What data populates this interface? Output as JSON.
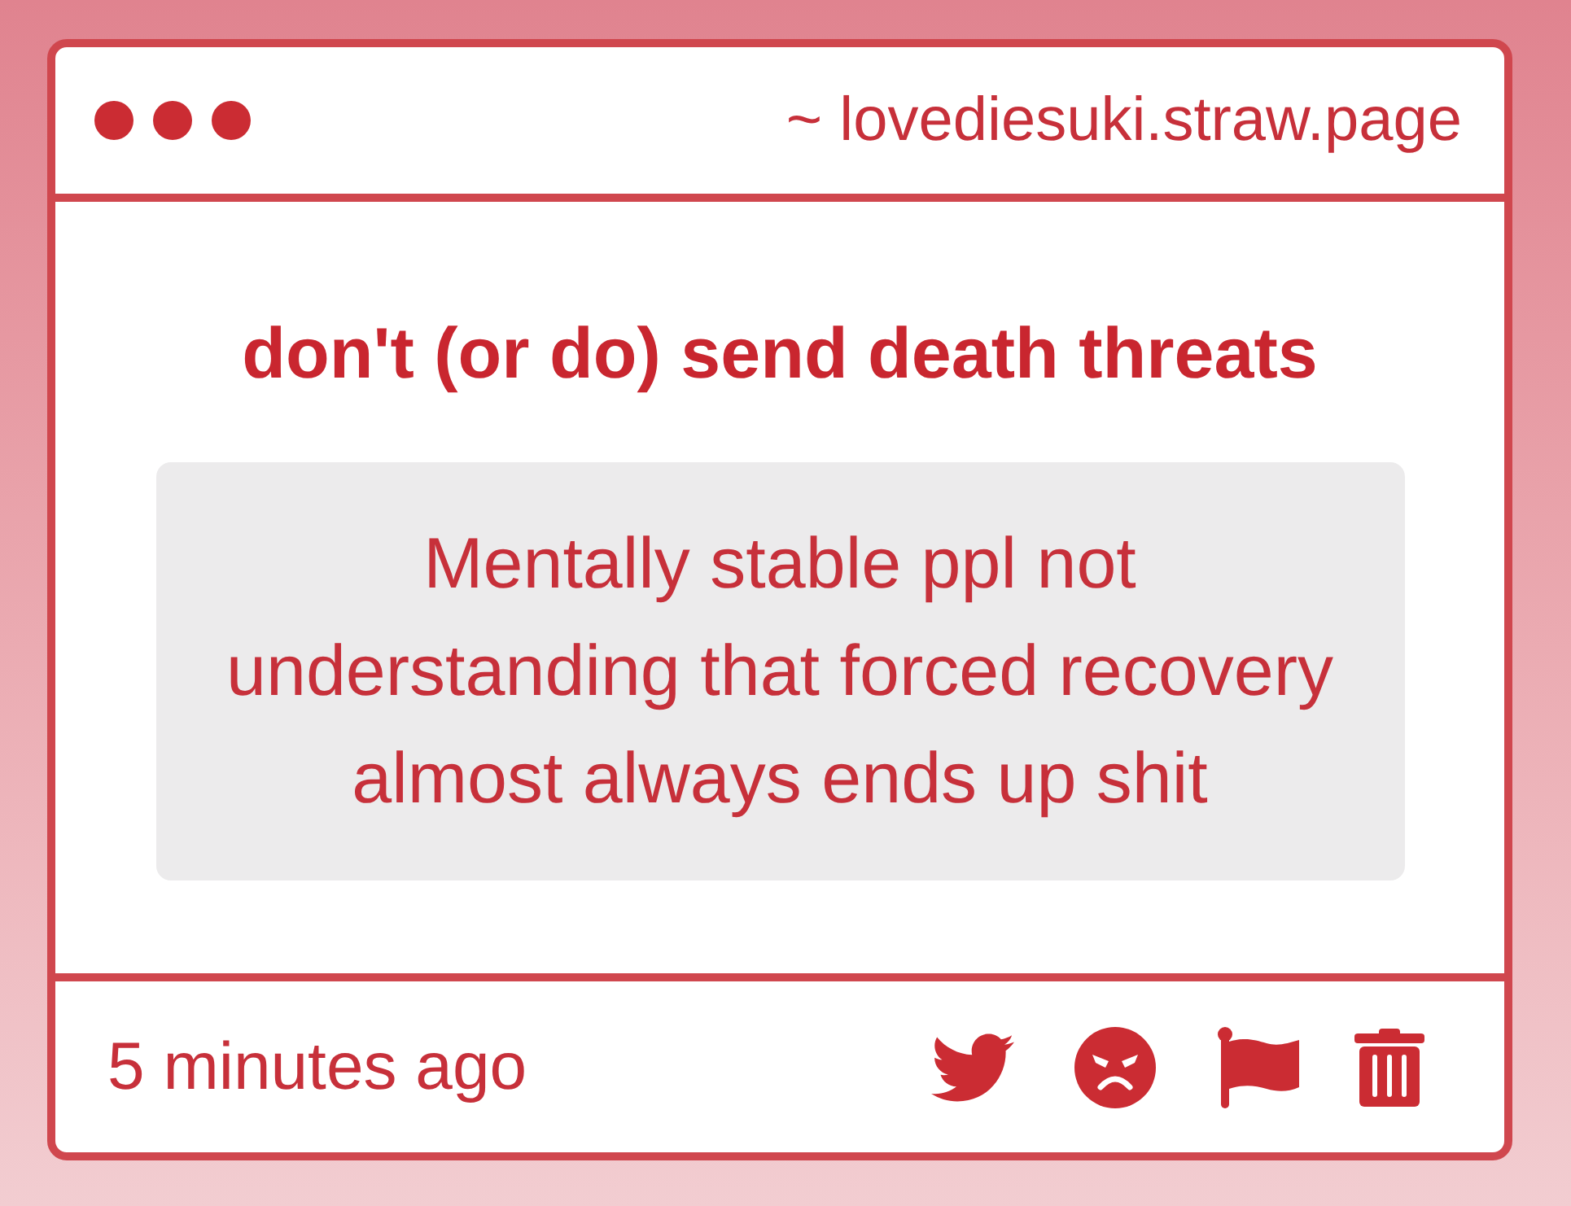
{
  "header": {
    "url": "~ lovediesuki.straw.page"
  },
  "post": {
    "title": "don't (or do) send death threats",
    "message": "Mentally stable ppl not understanding that forced recovery almost always ends up shit"
  },
  "footer": {
    "time": "5 minutes ago",
    "actions": [
      {
        "kind": "bird"
      },
      {
        "kind": "angry-face"
      },
      {
        "kind": "flag"
      },
      {
        "kind": "trash"
      }
    ]
  }
}
